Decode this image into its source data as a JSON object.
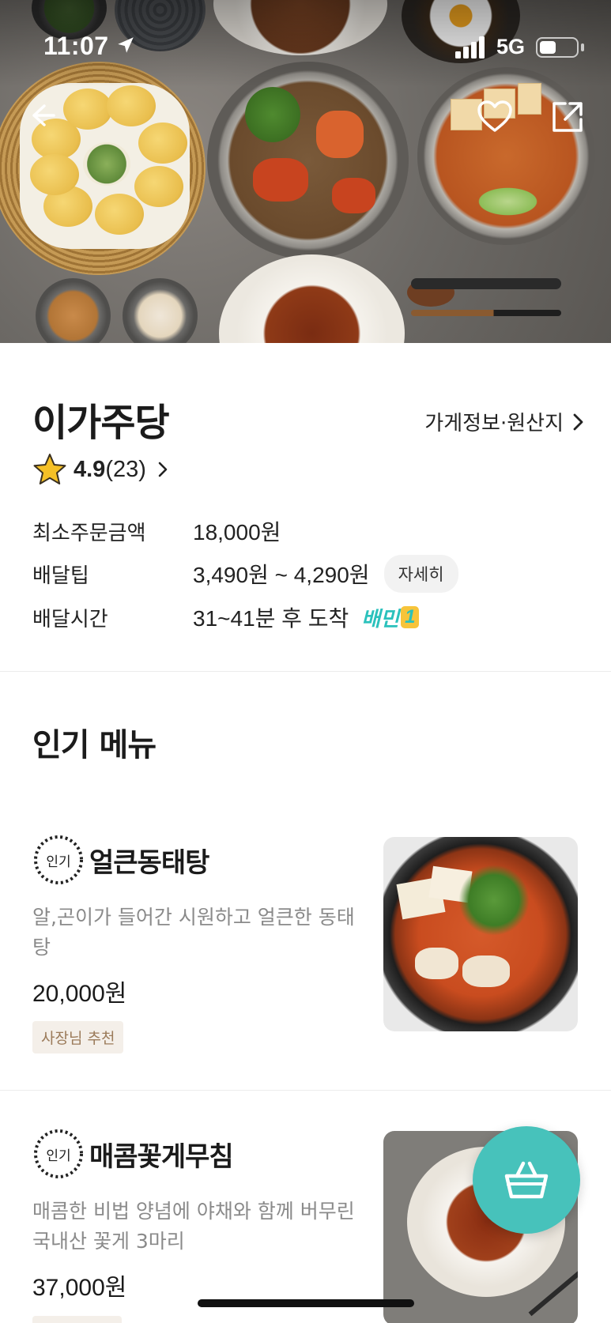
{
  "status_bar": {
    "time": "11:07",
    "network": "5G",
    "battery_level": 0.45
  },
  "store": {
    "name": "이가주당",
    "info_link": "가게정보·원산지",
    "rating": "4.9",
    "review_count": "(23)"
  },
  "details": {
    "min_order_label": "최소주문금액",
    "min_order_value": "18,000원",
    "delivery_tip_label": "배달팁",
    "delivery_tip_value": "3,490원 ~ 4,290원",
    "detail_button": "자세히",
    "delivery_time_label": "배달시간",
    "delivery_time_value": "31~41분 후 도착",
    "baemin_badge": "배민",
    "baemin_badge_num": "1"
  },
  "popular_section": {
    "title": "인기 메뉴",
    "items": [
      {
        "badge": "인기",
        "name": "얼큰동태탕",
        "description": "알,곤이가 들어간 시원하고 얼큰한 동태탕",
        "price": "20,000원",
        "tag": "사장님 추천"
      },
      {
        "badge": "인기",
        "name": "매콤꽃게무침",
        "description": "매콤한 비법 양념에 야채와 함께 버무린 국내산 꽃게 3마리",
        "price": "37,000원"
      }
    ]
  },
  "icons": {
    "back": "back-arrow-icon",
    "favorite": "heart-icon",
    "share": "share-icon",
    "cart": "basket-icon",
    "rating_star": "star-icon"
  },
  "colors": {
    "accent": "#47c2bb",
    "star": "#f5c026",
    "tag_bg": "#f4efe9",
    "tag_text": "#9b7b5a"
  }
}
